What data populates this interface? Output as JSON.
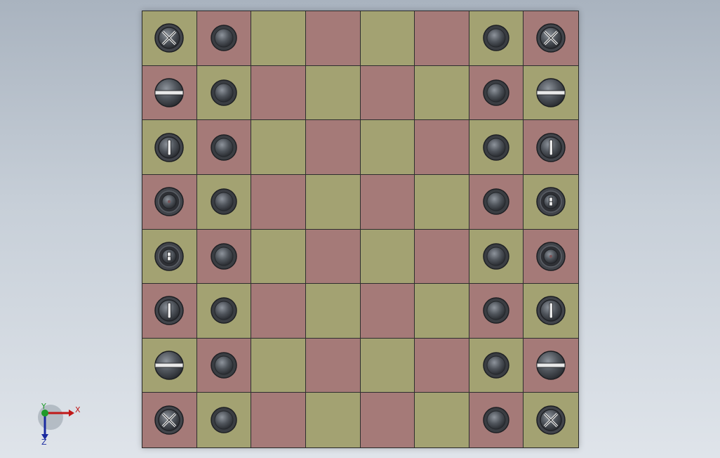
{
  "colors": {
    "light": "#a3a272",
    "dark": "#a57a78"
  },
  "board": {
    "rows": [
      [
        "cross-screw",
        "pawn",
        "",
        "",
        "",
        "",
        "pawn",
        "cross-screw"
      ],
      [
        "slotted-dome",
        "pawn",
        "",
        "",
        "",
        "",
        "pawn",
        "slotted-dome"
      ],
      [
        "slot-vertical",
        "pawn",
        "",
        "",
        "",
        "",
        "pawn",
        "slot-vertical"
      ],
      [
        "ring-dot",
        "pawn",
        "",
        "",
        "",
        "",
        "pawn",
        "ring-double-slot"
      ],
      [
        "ring-double-slot",
        "pawn",
        "",
        "",
        "",
        "",
        "pawn",
        "ring-dot"
      ],
      [
        "slot-vertical",
        "pawn",
        "",
        "",
        "",
        "",
        "pawn",
        "slot-vertical"
      ],
      [
        "slotted-dome",
        "pawn",
        "",
        "",
        "",
        "",
        "pawn",
        "slotted-dome"
      ],
      [
        "cross-screw",
        "pawn",
        "",
        "",
        "",
        "",
        "pawn",
        "cross-screw"
      ]
    ]
  },
  "triad": {
    "x_label": "X",
    "y_label": "Y",
    "z_label": "Z"
  }
}
